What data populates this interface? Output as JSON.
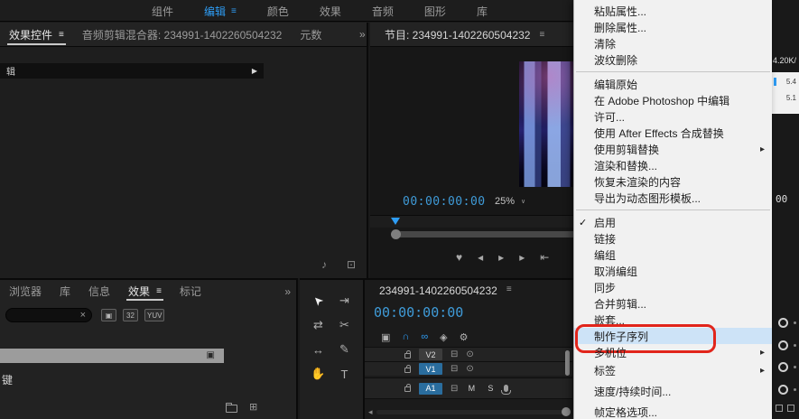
{
  "colors": {
    "accent": "#2e9df5",
    "timecode_blue": "#3f9bd8",
    "annotation_red": "#e1251b",
    "menu_highlight": "#cde3f7",
    "track_label_blue": "#2a6d9e"
  },
  "top_bar": {
    "menu_glyph": "≡",
    "tabs": [
      {
        "name": "components",
        "label": "组件"
      },
      {
        "name": "edit",
        "label": "编辑",
        "active": true
      },
      {
        "name": "color",
        "label": "颜色"
      },
      {
        "name": "effects",
        "label": "效果"
      },
      {
        "name": "audio",
        "label": "音频"
      },
      {
        "name": "graphics",
        "label": "图形"
      },
      {
        "name": "libraries",
        "label": "库"
      }
    ]
  },
  "left_panel": {
    "overflow_glyph": "»",
    "tabs": [
      {
        "name": "effect-controls",
        "label": "效果控件",
        "active": true,
        "menu_glyph": "≡"
      },
      {
        "name": "audio-clip-mixer",
        "label": "音频剪辑混合器: 234991-1402260504232"
      },
      {
        "name": "metadata",
        "label": "元数"
      }
    ],
    "clip_strip": {
      "partial_label": "辑",
      "expander_glyph": "▶"
    },
    "corner_icons": [
      {
        "name": "mute-audio-icon",
        "glyph": "♪"
      },
      {
        "name": "panel-options-icon",
        "glyph": "⊡"
      }
    ]
  },
  "program_panel": {
    "title": "节目: 234991-1402260504232",
    "menu_glyph": "≡",
    "timecode": "00:00:00:00",
    "zoom_value": "25%",
    "dropdown_glyph": "∨",
    "transport": [
      {
        "name": "add-marker-icon",
        "glyph": "♥"
      },
      {
        "name": "step-back-icon",
        "glyph": "◂"
      },
      {
        "name": "play-icon",
        "glyph": "▸"
      },
      {
        "name": "step-forward-icon",
        "glyph": "▸"
      },
      {
        "name": "goto-in-icon",
        "glyph": "⇤"
      }
    ]
  },
  "effects_panel": {
    "overflow_glyph": "»",
    "tabs": [
      {
        "name": "browser",
        "label": "浏览器"
      },
      {
        "name": "libraries",
        "label": "库"
      },
      {
        "name": "info",
        "label": "信息"
      },
      {
        "name": "effects",
        "label": "效果",
        "active": true,
        "menu_glyph": "≡"
      },
      {
        "name": "markers",
        "label": "标记"
      }
    ],
    "search_value": "",
    "clear_glyph": "×",
    "filters": [
      {
        "name": "accelerated-effects-filter-icon",
        "glyph": "▣"
      },
      {
        "name": "32bit-filter-icon",
        "glyph": "32"
      },
      {
        "name": "yuv-filter-icon",
        "glyph": "YUV"
      }
    ],
    "selected_row_icon": "▣",
    "partial_item": "键"
  },
  "tools_panel": {
    "tools": [
      {
        "name": "selection-tool",
        "glyph": "➤",
        "active": true
      },
      {
        "name": "track-select-forward-tool",
        "glyph": "⇥"
      },
      {
        "name": "ripple-edit-tool",
        "glyph": "⇄"
      },
      {
        "name": "razor-tool",
        "glyph": "✂"
      },
      {
        "name": "slip-tool",
        "glyph": "↔"
      },
      {
        "name": "pen-tool",
        "glyph": "✎"
      },
      {
        "name": "hand-tool",
        "glyph": "✋"
      },
      {
        "name": "type-tool",
        "glyph": "T"
      }
    ]
  },
  "timeline_panel": {
    "title": "234991-1402260504232",
    "menu_glyph": "≡",
    "timecode": "00:00:00:00",
    "scroll_left_glyph": "◂",
    "sync_lock_glyph": "⊟",
    "eye_glyph": "⊙",
    "toolbar": [
      {
        "name": "nested-sequence-icon",
        "glyph": "▣"
      },
      {
        "name": "snap-icon",
        "glyph": "∩",
        "active": true
      },
      {
        "name": "linked-selection-icon",
        "glyph": "∞",
        "active": true
      },
      {
        "name": "add-marker-icon",
        "glyph": "◈"
      },
      {
        "name": "timeline-settings-icon",
        "glyph": "⚙"
      }
    ],
    "tracks": [
      {
        "label": "V2",
        "type": "video",
        "selected": false
      },
      {
        "label": "V1",
        "type": "video",
        "selected": true
      },
      {
        "label": "A1",
        "type": "audio",
        "selected": true,
        "mute": "M",
        "solo": "S"
      }
    ]
  },
  "right_strip": {
    "bitrate_fragment": "4.20K/",
    "info_values": [
      "5.4",
      "5.1"
    ],
    "duration_fragment": "00"
  },
  "context_menu": {
    "check_glyph": "✓",
    "submenu_glyph": "▸",
    "items": [
      {
        "name": "paste-attributes",
        "label": "粘贴属性..."
      },
      {
        "name": "remove-attributes",
        "label": "删除属性..."
      },
      {
        "name": "clear",
        "label": "清除"
      },
      {
        "name": "ripple-delete",
        "label": "波纹删除"
      },
      {
        "type": "separator"
      },
      {
        "name": "edit-original",
        "label": "编辑原始"
      },
      {
        "name": "edit-in-photoshop",
        "label": "在 Adobe Photoshop 中编辑"
      },
      {
        "name": "license",
        "label": "许可..."
      },
      {
        "name": "replace-with-ae-composition",
        "label": "使用 After Effects 合成替换"
      },
      {
        "name": "replace-with-clip",
        "label": "使用剪辑替换",
        "submenu": true
      },
      {
        "name": "render-and-replace",
        "label": "渲染和替换..."
      },
      {
        "name": "restore-unrendered",
        "label": "恢复未渲染的内容"
      },
      {
        "name": "export-motion-graphics-template",
        "label": "导出为动态图形模板..."
      },
      {
        "type": "separator"
      },
      {
        "name": "enable",
        "label": "启用",
        "checked": true
      },
      {
        "name": "link",
        "label": "链接"
      },
      {
        "name": "group",
        "label": "编组"
      },
      {
        "name": "ungroup",
        "label": "取消编组"
      },
      {
        "name": "synchronize",
        "label": "同步"
      },
      {
        "name": "merge-clips",
        "label": "合并剪辑..."
      },
      {
        "name": "nest",
        "label": "嵌套..."
      },
      {
        "name": "make-subsequence",
        "label": "制作子序列",
        "highlighted": true,
        "annotated": true
      },
      {
        "name": "multi-camera",
        "label": "多机位",
        "submenu": true
      },
      {
        "name": "label",
        "label": "标签",
        "submenu": true
      },
      {
        "name": "speed-duration",
        "label": "速度/持续时间..."
      },
      {
        "name": "frame-hold-options",
        "label": "帧定格选项..."
      }
    ]
  }
}
